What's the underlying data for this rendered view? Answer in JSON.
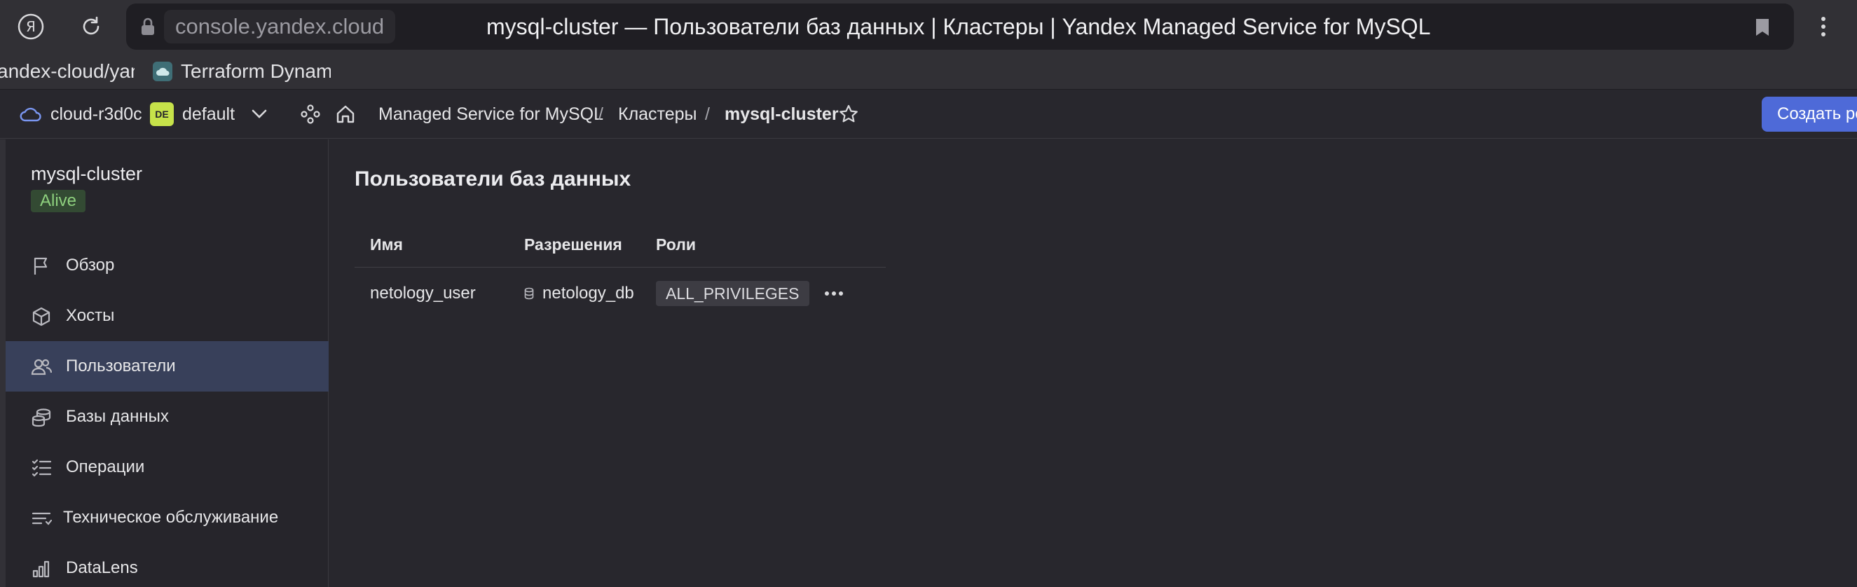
{
  "browser": {
    "url": "console.yandex.cloud",
    "title": "mysql-cluster — Пользователи баз данных | Кластеры | Yandex Managed Service for MySQL",
    "bookmarks": [
      {
        "label": "andex-cloud/yandex"
      },
      {
        "label": "Terraform Dynamic"
      }
    ]
  },
  "console": {
    "cloud": "cloud-r3d0c",
    "folder_badge": "DE",
    "folder": "default",
    "breadcrumbs": [
      "Managed Service for MySQL",
      "Кластеры",
      "mysql-cluster"
    ],
    "separator": "/",
    "create_button": "Создать ресурс"
  },
  "sidebar": {
    "cluster_name": "mysql-cluster",
    "status": "Alive",
    "items": [
      {
        "label": "Обзор",
        "icon": "flag-icon"
      },
      {
        "label": "Хосты",
        "icon": "cube-icon"
      },
      {
        "label": "Пользователи",
        "icon": "users-icon",
        "active": true
      },
      {
        "label": "Базы данных",
        "icon": "databases-icon"
      },
      {
        "label": "Операции",
        "icon": "list-check-icon"
      },
      {
        "label": "Техническое обслуживание",
        "icon": "maintenance-icon"
      },
      {
        "label": "DataLens",
        "icon": "bar-chart-icon"
      }
    ]
  },
  "main": {
    "title": "Пользователи баз данных",
    "table": {
      "columns": [
        "Имя",
        "Разрешения",
        "Роли"
      ],
      "rows": [
        {
          "name": "netology_user",
          "permission": "netology_db",
          "role": "ALL_PRIVILEGES"
        }
      ]
    }
  },
  "colors": {
    "accent": "#4e6ad8",
    "status_alive": "#8ed07e",
    "folder_badge": "#c6e24a",
    "active_nav": "#38405a"
  }
}
